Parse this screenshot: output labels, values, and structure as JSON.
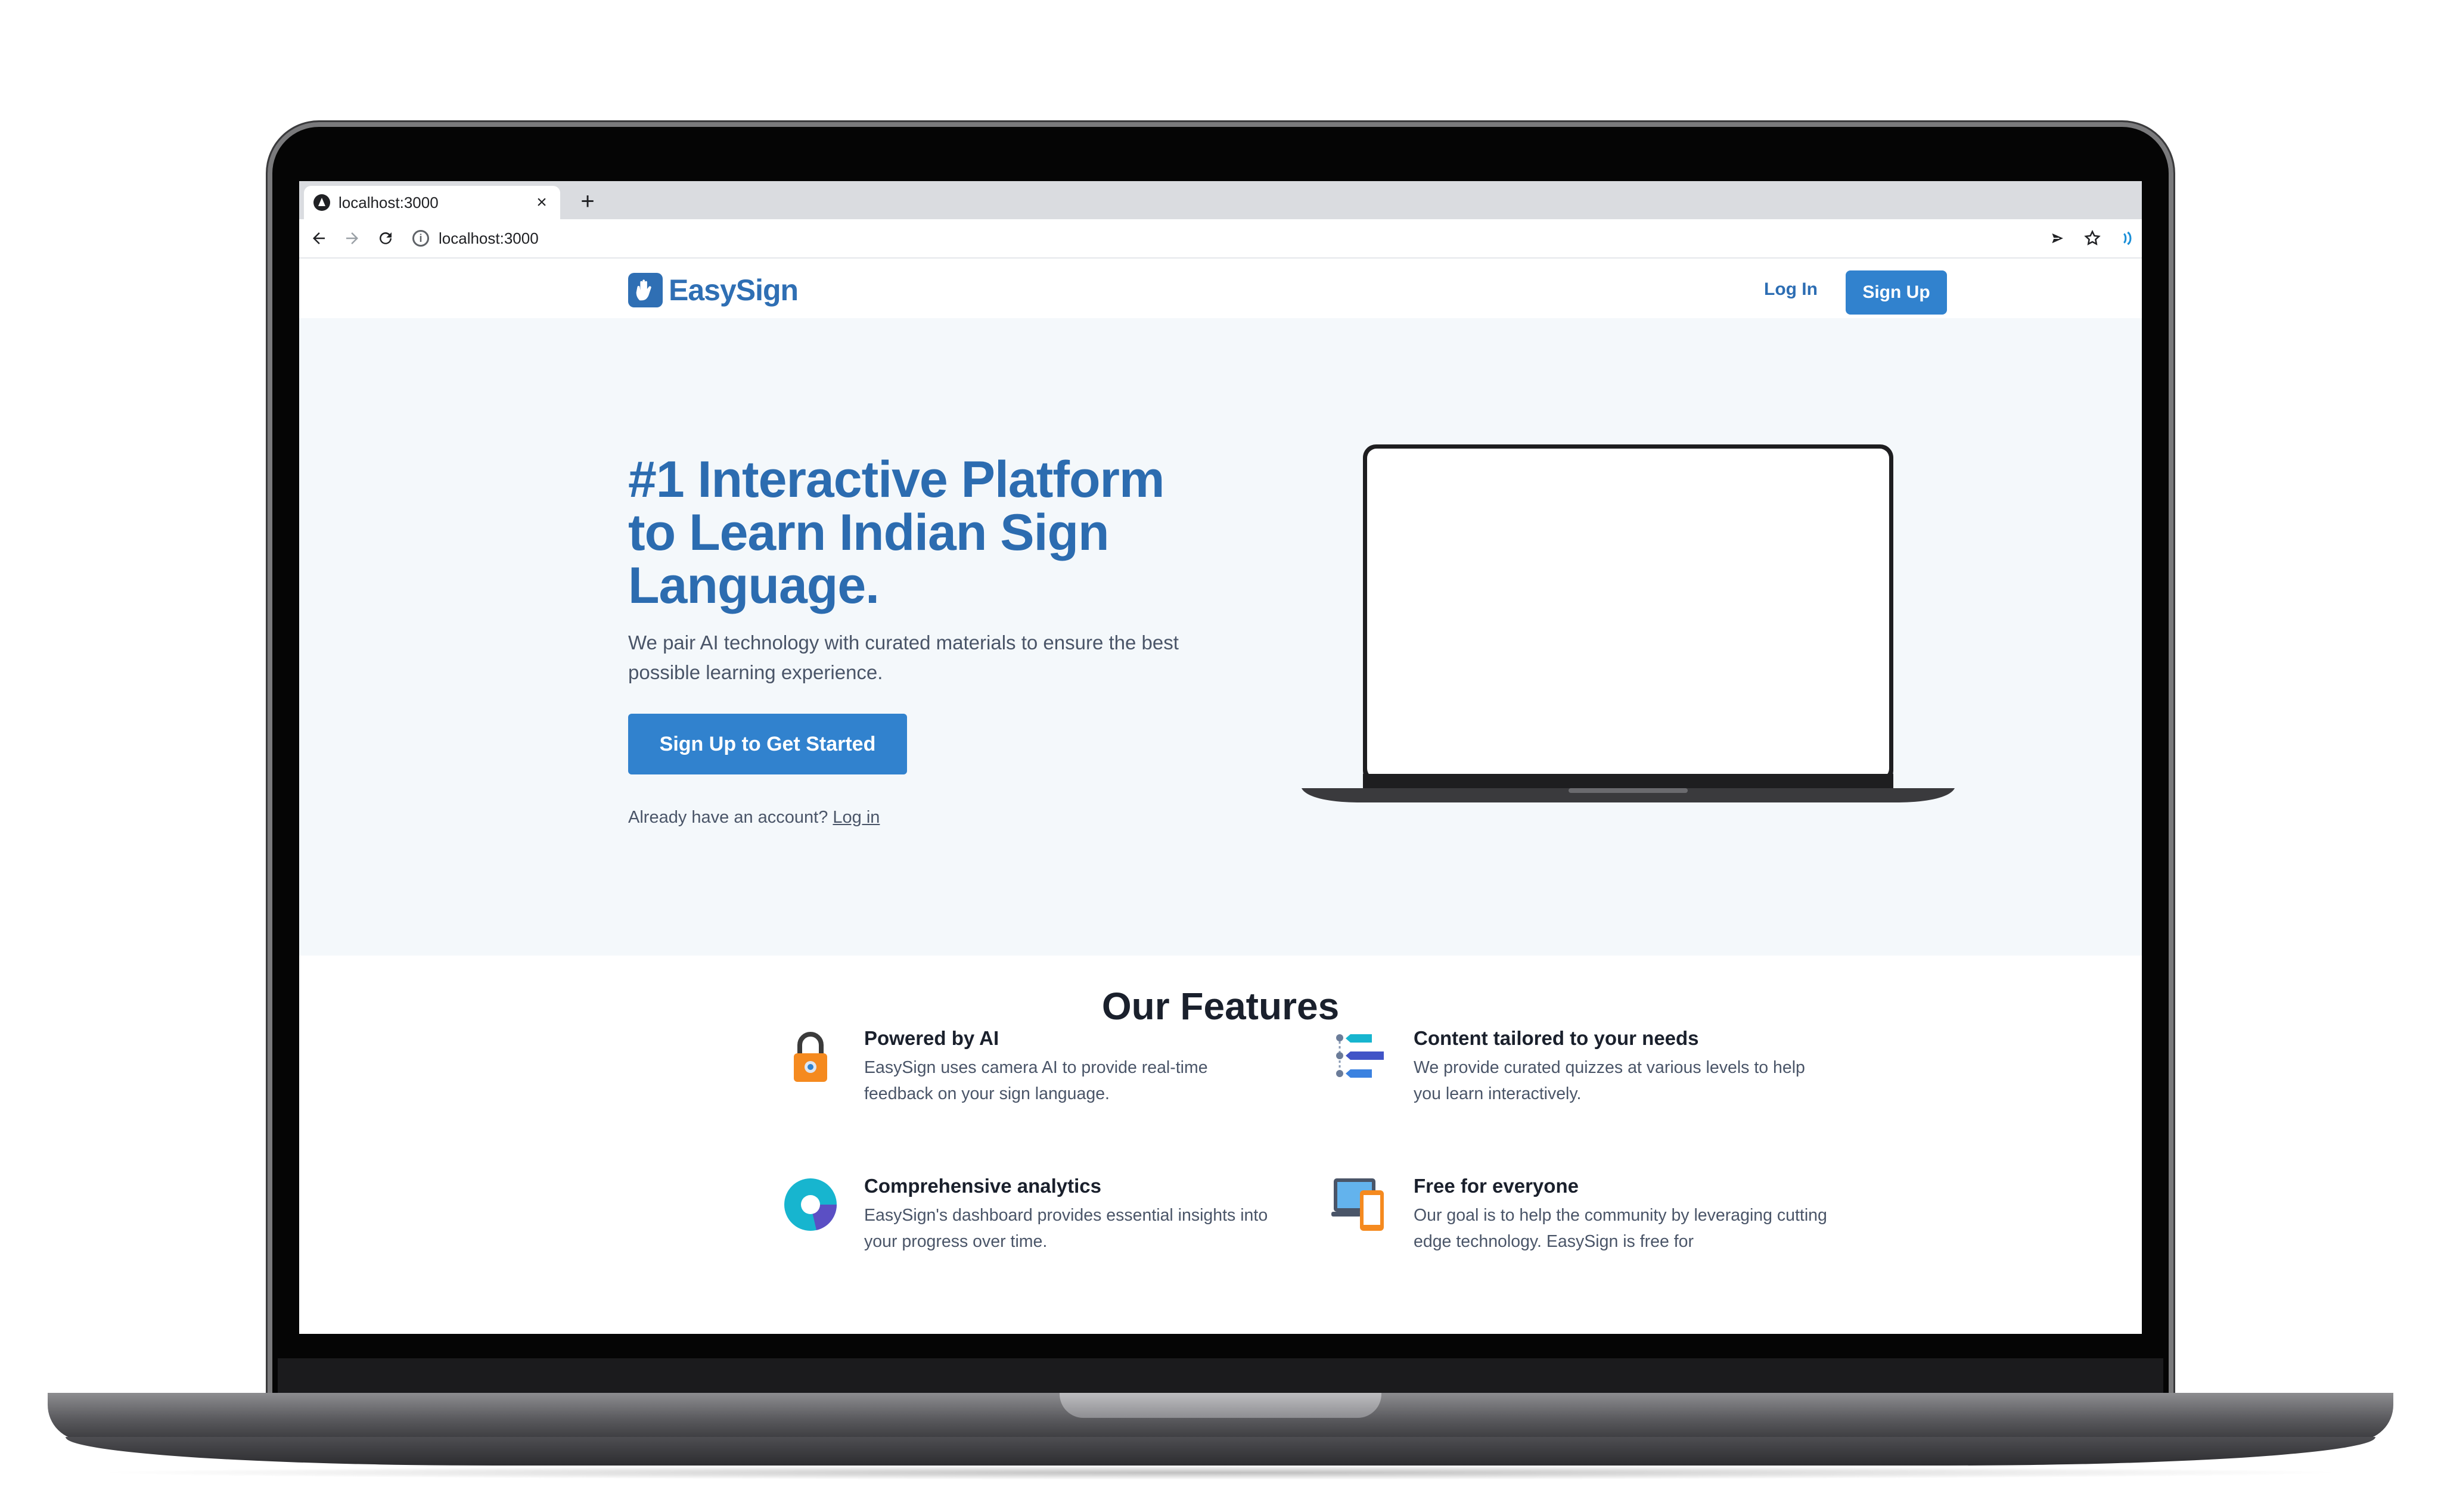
{
  "browser": {
    "tab_title": "localhost:3000",
    "tab_close": "×",
    "new_tab": "+",
    "url": "localhost:3000"
  },
  "navbar": {
    "logo_text": "EasySign",
    "login_label": "Log In",
    "signup_label": "Sign Up"
  },
  "hero": {
    "title": "#1 Interactive Platform to Learn Indian Sign Language.",
    "subtitle": "We pair AI technology with curated materials to ensure the best possible learning experience.",
    "cta_label": "Sign Up to Get Started",
    "already_text": "Already have an account?",
    "login_link": "Log in"
  },
  "features": {
    "title": "Our Features",
    "items": [
      {
        "title": "Powered by AI",
        "desc": "EasySign uses camera AI to provide real-time feedback on your sign language.",
        "icon": "lock-icon"
      },
      {
        "title": "Content tailored to your needs",
        "desc": "We provide curated quizzes at various levels to help you learn interactively.",
        "icon": "list-icon"
      },
      {
        "title": "Comprehensive analytics",
        "desc": "EasySign's dashboard provides essential insights into your progress over time.",
        "icon": "donut-chart-icon"
      },
      {
        "title": "Free for everyone",
        "desc": "Our goal is to help the community by leveraging cutting edge technology. EasySign is free for",
        "icon": "devices-icon"
      }
    ]
  },
  "colors": {
    "brand": "#2f6fb4",
    "button": "#3182ce",
    "hero_bg": "#f4f8fb"
  }
}
